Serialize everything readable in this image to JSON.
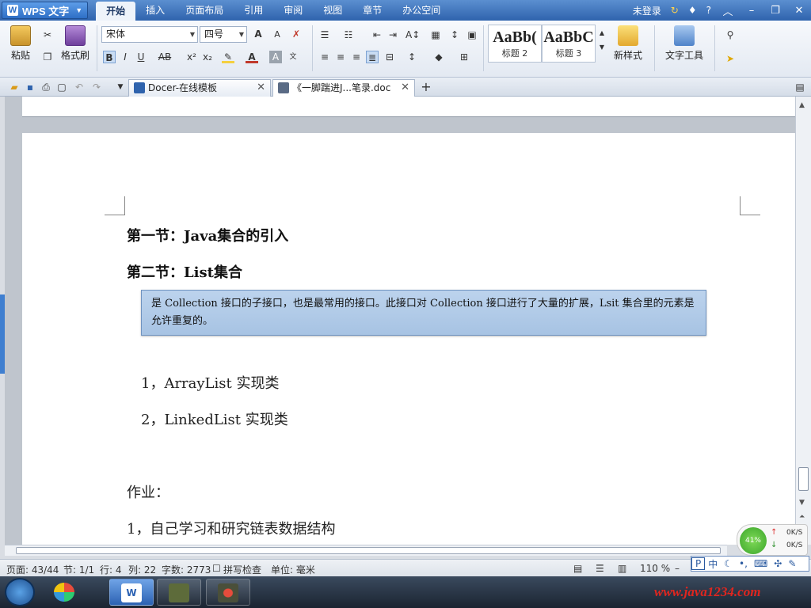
{
  "app": {
    "name": "WPS 文字",
    "logo": "W"
  },
  "menu": {
    "tabs": [
      "开始",
      "插入",
      "页面布局",
      "引用",
      "审阅",
      "视图",
      "章节",
      "办公空间"
    ],
    "active": 0,
    "login": "未登录",
    "help": "?"
  },
  "ribbon": {
    "paste": "粘贴",
    "format_painter": "格式刷",
    "font_name": "宋体",
    "font_size": "四号",
    "styles": [
      {
        "sample": "AaBb(",
        "caption": "标题 2"
      },
      {
        "sample": "AaBbC",
        "caption": "标题 3"
      }
    ],
    "new_style": "新样式",
    "text_tools": "文字工具"
  },
  "doc_tabs": [
    {
      "label": "Docer-在线模板",
      "active": false
    },
    {
      "label": "《一脚踹进J...笔录.doc",
      "active": true
    }
  ],
  "document": {
    "heading1": "第一节：Java集合的引入",
    "heading2": "第二节：List集合",
    "note": "是 Collection 接口的子接口，也是最常用的接口。此接口对 Collection 接口进行了大量的扩展，Lsit 集合里的元素是允许重复的。",
    "item1": "1，ArrayList 实现类",
    "item2": "2，LinkedList 实现类",
    "homework_title": "作业：",
    "homework1": "1，自己学习和研究链表数据结构"
  },
  "status": {
    "page": "页面: 43/44",
    "section": "节: 1/1",
    "row": "行: 4",
    "col": "列: 22",
    "word_count": "字数: 2773",
    "spell_check": "拼写检查",
    "unit": "单位: 毫米",
    "zoom": "110 %"
  },
  "network": {
    "percent": "41%",
    "up": "0K/S",
    "down": "0K/S"
  },
  "ime": {
    "mode": "中"
  },
  "watermark": "www.java1234.com",
  "colors": {
    "accent": "#2f63ad",
    "note_bg": "#a7c3e3",
    "watermark": "#e0261f"
  }
}
